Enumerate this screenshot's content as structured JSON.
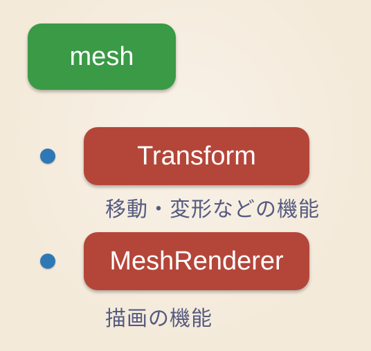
{
  "root_node": {
    "label": "mesh",
    "color": "#3a9a46"
  },
  "components": [
    {
      "label": "Transform",
      "description": "移動・変形などの機能",
      "color": "#b44639"
    },
    {
      "label": "MeshRenderer",
      "description": "描画の機能",
      "color": "#b44639"
    }
  ],
  "bullet_color": "#2e78b6"
}
